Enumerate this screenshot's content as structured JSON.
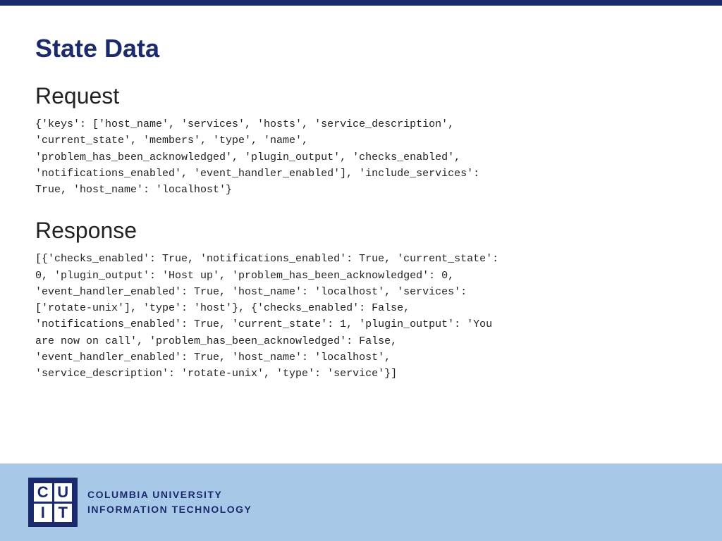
{
  "page": {
    "title": "State Data",
    "topbar_color": "#1a2a6c"
  },
  "request": {
    "section_title": "Request",
    "code": "{'keys': ['host_name', 'services', 'hosts', 'service_description',\n'current_state', 'members', 'type', 'name',\n'problem_has_been_acknowledged', 'plugin_output', 'checks_enabled',\n'notifications_enabled', 'event_handler_enabled'], 'include_services':\nTrue, 'host_name': 'localhost'}"
  },
  "response": {
    "section_title": "Response",
    "code": "[{'checks_enabled': True, 'notifications_enabled': True, 'current_state':\n0, 'plugin_output': 'Host up', 'problem_has_been_acknowledged': 0,\n'event_handler_enabled': True, 'host_name': 'localhost', 'services':\n['rotate-unix'], 'type': 'host'}, {'checks_enabled': False,\n'notifications_enabled': True, 'current_state': 1, 'plugin_output': 'You\nare now on call', 'problem_has_been_acknowledged': False,\n'event_handler_enabled': True, 'host_name': 'localhost',\n'service_description': 'rotate-unix', 'type': 'service'}]"
  },
  "footer": {
    "logo_letters": [
      "C",
      "U",
      "I",
      "T"
    ],
    "org_line1": "COLUMBIA UNIVERSITY",
    "org_line2": "INFORMATION TECHNOLOGY"
  }
}
